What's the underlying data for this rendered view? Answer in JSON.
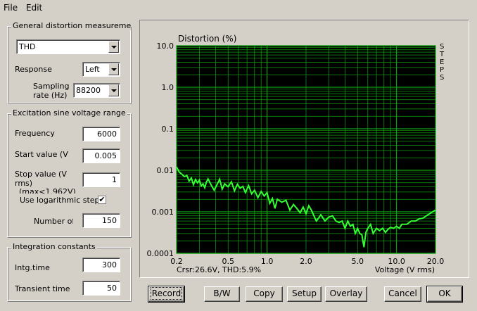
{
  "menu": {
    "file": "File",
    "edit": "Edit"
  },
  "general": {
    "title": "General distortion measuremen",
    "type_value": "THD",
    "response_label": "Response",
    "response_value": "Left",
    "sampling_label_1": "Sampling",
    "sampling_label_2": "rate (Hz)",
    "sampling_value": "88200"
  },
  "excitation": {
    "title": "Excitation sine voltage range",
    "frequency_label": "Frequency",
    "frequency_value": "6000",
    "start_label": "Start value (V",
    "start_value": "0.005",
    "stop_label_1": "Stop value (V",
    "stop_label_2": "rms)",
    "stop_label_3": "(max<1.962V)",
    "stop_value": "1",
    "log_label": "Use logarithmic step",
    "log_checked": true,
    "count_label": "Number of",
    "count_value": "150"
  },
  "integration": {
    "title": "Integration constants",
    "intg_label": "Intg.time",
    "intg_value": "300",
    "transient_label": "Transient time",
    "transient_value": "50"
  },
  "buttons": {
    "record": "Record",
    "bw": "B/W",
    "copy": "Copy",
    "setup": "Setup",
    "overlay": "Overlay",
    "cancel": "Cancel",
    "ok": "OK"
  },
  "chart_data": {
    "type": "line",
    "title": "Distortion (%)",
    "xlabel": "Voltage (V rms)",
    "side_label": "STEPS",
    "cursor_readout": "Crsr:26.6V, THD:5.9%",
    "x_scale": "log",
    "y_scale": "log",
    "xlim": [
      0.2,
      20.0
    ],
    "ylim": [
      0.0001,
      10.0
    ],
    "grid": true,
    "x_ticks": [
      0.2,
      0.5,
      1.0,
      2.0,
      5.0,
      10.0,
      20.0
    ],
    "x_tick_labels": [
      "0.2",
      "0.5",
      "1.0",
      "2.0",
      "5.0",
      "10.0",
      "20.0"
    ],
    "y_ticks": [
      0.0001,
      0.001,
      0.01,
      0.1,
      1.0,
      10.0
    ],
    "y_tick_labels": [
      "0.0001",
      "0.001",
      "0.01",
      "0.1",
      "1.0",
      "10.0"
    ],
    "colors": {
      "background": "#000000",
      "grid": "#10a010",
      "line": "#33ff33"
    },
    "series": [
      {
        "x": [
          0.2,
          0.21,
          0.22,
          0.23,
          0.24,
          0.25,
          0.26,
          0.27,
          0.28,
          0.29,
          0.3,
          0.31,
          0.32,
          0.33,
          0.34,
          0.35,
          0.37,
          0.39,
          0.41,
          0.43,
          0.45,
          0.47,
          0.5,
          0.53,
          0.56,
          0.59,
          0.62,
          0.65,
          0.68,
          0.72,
          0.76,
          0.8,
          0.85,
          0.9,
          0.95,
          1.0,
          1.05,
          1.1,
          1.15,
          1.2,
          1.3,
          1.4,
          1.5,
          1.6,
          1.7,
          1.8,
          1.9,
          2.0,
          2.1,
          2.2,
          2.3,
          2.4,
          2.5,
          2.6,
          2.8,
          3.0,
          3.2,
          3.4,
          3.6,
          3.8,
          4.0,
          4.2,
          4.4,
          4.6,
          4.8,
          5.0,
          5.2,
          5.4,
          5.6,
          5.8,
          6.0,
          6.3,
          6.6,
          7.0,
          7.4,
          7.8,
          8.2,
          8.6,
          9.0,
          9.5,
          10.0,
          10.5,
          11.0,
          12.0,
          13.0,
          14.0,
          15.0,
          16.0,
          17.0,
          18.0,
          19.0,
          20.0
        ],
        "y": [
          0.012,
          0.009,
          0.008,
          0.007,
          0.0075,
          0.0055,
          0.0065,
          0.0045,
          0.006,
          0.005,
          0.0058,
          0.0042,
          0.0047,
          0.0038,
          0.0052,
          0.0062,
          0.0044,
          0.0033,
          0.0045,
          0.0061,
          0.0035,
          0.0047,
          0.004,
          0.0053,
          0.0032,
          0.0046,
          0.0037,
          0.0041,
          0.0029,
          0.0043,
          0.0027,
          0.0033,
          0.0022,
          0.0031,
          0.0024,
          0.0029,
          0.0016,
          0.0021,
          0.0012,
          0.002,
          0.0017,
          0.0019,
          0.0011,
          0.0015,
          0.0012,
          0.00095,
          0.0013,
          0.0009,
          0.0014,
          0.0011,
          0.0008,
          0.0006,
          0.0007,
          0.00085,
          0.0006,
          0.00075,
          0.0008,
          0.0006,
          0.00055,
          0.0006,
          0.0004,
          0.0006,
          0.00045,
          0.0005,
          0.0003,
          0.0004,
          0.0003,
          0.00028,
          0.00014,
          0.00032,
          0.0004,
          0.0005,
          0.0003,
          0.0004,
          0.00035,
          0.0004,
          0.00032,
          0.00038,
          0.00042,
          0.0004,
          0.00045,
          0.0004,
          0.0005,
          0.0005,
          0.0006,
          0.0006,
          0.00068,
          0.0007,
          0.0008,
          0.0009,
          0.001,
          0.0011
        ]
      }
    ]
  }
}
